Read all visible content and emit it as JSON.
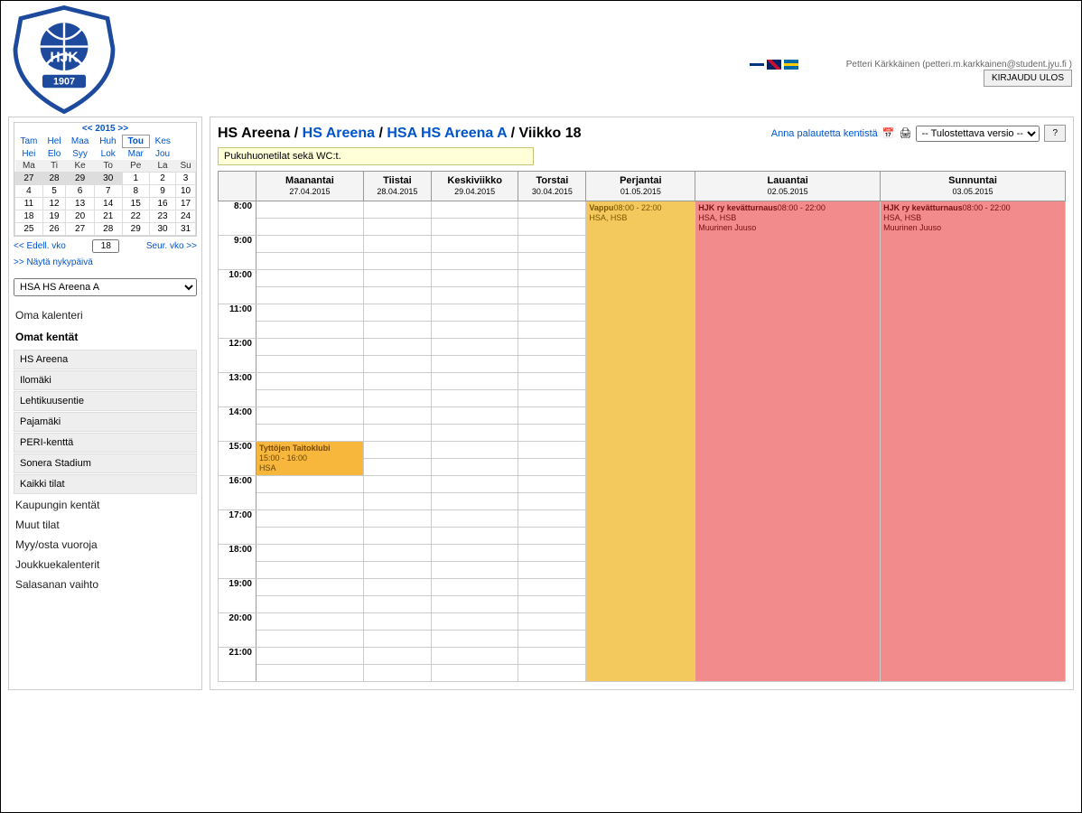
{
  "user": {
    "name": "Petteri Kärkkäinen",
    "email": "(petteri.m.karkkainen@student.jyu.fi )",
    "logout": "KIRJAUDU ULOS"
  },
  "miniCal": {
    "yearLabel": "<< 2015 >>",
    "months1": [
      "Tam",
      "Hel",
      "Maa",
      "Huh",
      "Tou",
      "Kes"
    ],
    "months2": [
      "Hei",
      "Elo",
      "Syy",
      "Lok",
      "Mar",
      "Jou"
    ],
    "weekdays": [
      "Ma",
      "Ti",
      "Ke",
      "To",
      "Pe",
      "La",
      "Su"
    ],
    "rows": [
      [
        "27",
        "28",
        "29",
        "30",
        "1",
        "2",
        "3"
      ],
      [
        "4",
        "5",
        "6",
        "7",
        "8",
        "9",
        "10"
      ],
      [
        "11",
        "12",
        "13",
        "14",
        "15",
        "16",
        "17"
      ],
      [
        "18",
        "19",
        "20",
        "21",
        "22",
        "23",
        "24"
      ],
      [
        "25",
        "26",
        "27",
        "28",
        "29",
        "30",
        "31"
      ]
    ],
    "prevWeek": "<< Edell. vko",
    "weekNum": "18",
    "nextWeek": "Seur. vko >>",
    "today": ">> Näytä nykypäivä"
  },
  "fieldSelected": "HSA HS Areena A",
  "nav": {
    "ownCal": "Oma kalenteri",
    "ownFields": "Omat kentät",
    "fields": [
      "HS Areena",
      "Ilomäki",
      "Lehtikuusentie",
      "Pajamäki",
      "PERI-kenttä",
      "Sonera Stadium",
      "Kaikki tilat"
    ],
    "others": [
      "Kaupungin kentät",
      "Muut tilat",
      "Myy/osta vuoroja",
      "Joukkuekalenterit",
      "Salasanan vaihto"
    ]
  },
  "breadcrumb": {
    "a": "HS Areena",
    "sep": " / ",
    "b": "HS Areena",
    "c": "HSA HS Areena A",
    "d": "Viikko 18",
    "feedback": "Anna palautetta kentistä",
    "printSel": "-- Tulostettava versio --",
    "help": "?"
  },
  "infoStrip": "Pukuhuonetilat sekä WC:t.",
  "days": [
    {
      "name": "Maanantai",
      "date": "27.04.2015"
    },
    {
      "name": "Tiistai",
      "date": "28.04.2015"
    },
    {
      "name": "Keskiviikko",
      "date": "29.04.2015"
    },
    {
      "name": "Torstai",
      "date": "30.04.2015"
    },
    {
      "name": "Perjantai",
      "date": "01.05.2015"
    },
    {
      "name": "Lauantai",
      "date": "02.05.2015"
    },
    {
      "name": "Sunnuntai",
      "date": "03.05.2015"
    }
  ],
  "times": [
    "8:00",
    "9:00",
    "10:00",
    "11:00",
    "12:00",
    "13:00",
    "14:00",
    "15:00",
    "16:00",
    "17:00",
    "18:00",
    "19:00",
    "20:00",
    "21:00"
  ],
  "events": {
    "mon15": {
      "title": "Tyttöjen Taitoklubi",
      "time": "15:00 - 16:00",
      "loc": "HSA"
    },
    "fri": {
      "title": "Vappu",
      "time": "08:00 - 22:00",
      "loc": "HSA, HSB"
    },
    "sat": {
      "title": "HJK ry kevätturnaus",
      "time": "08:00 - 22:00",
      "loc": "HSA, HSB",
      "who": "Muurinen Juuso"
    },
    "sun": {
      "title": "HJK ry kevätturnaus",
      "time": "08:00 - 22:00",
      "loc": "HSA, HSB",
      "who": "Muurinen Juuso"
    }
  }
}
